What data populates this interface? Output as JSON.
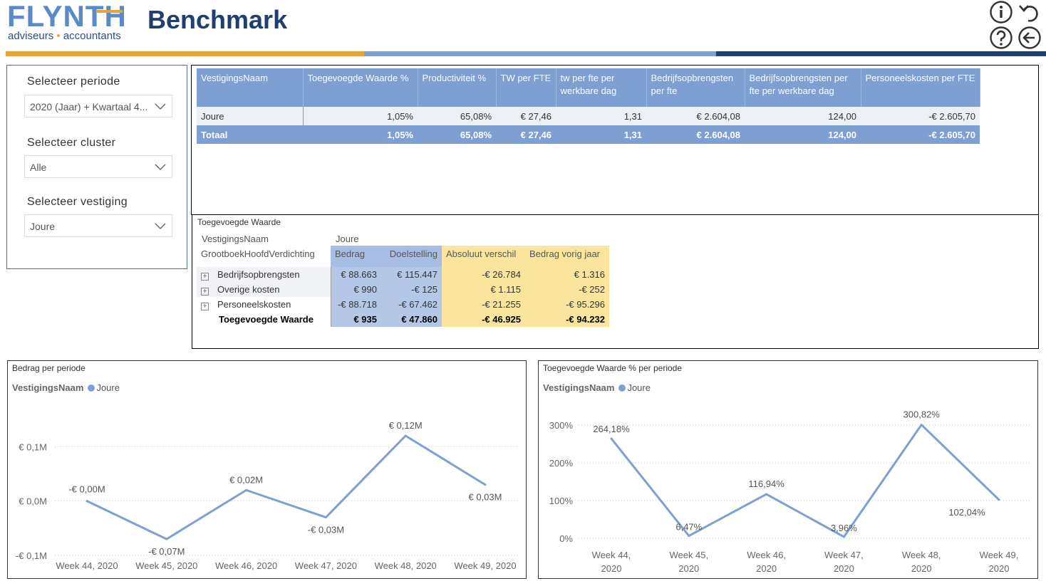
{
  "header": {
    "logo_main": "FLYNTH",
    "logo_sub_left": "adviseurs",
    "logo_sub_dot": "•",
    "logo_sub_right": "accountants",
    "page_title": "Benchmark",
    "bar_colors": [
      "#e8a23a",
      "#7e9fcf",
      "#1f3f73"
    ],
    "icons": [
      "info-icon",
      "undo-icon",
      "help-icon",
      "back-arrow-icon"
    ]
  },
  "slicers": [
    {
      "label": "Selecteer periode",
      "value": "2020 (Jaar) + Kwartaal 4..."
    },
    {
      "label": "Selecteer cluster",
      "value": "Alle"
    },
    {
      "label": "Selecteer vestiging",
      "value": "Joure"
    }
  ],
  "kpi_table": {
    "columns": [
      "VestigingsNaam",
      "Toegevoegde Waarde %",
      "Productiviteit %",
      "TW per FTE",
      "tw per fte per werkbare dag",
      "Bedrijfsopbrengsten per fte",
      "Bedrijfsopbrengsten per fte per werkbare dag",
      "Personeelskosten per FTE"
    ],
    "rows": [
      [
        "Joure",
        "1,05%",
        "65,08%",
        "€ 27,46",
        "1,31",
        "€ 2.604,08",
        "124,00",
        "-€ 2.605,70"
      ]
    ],
    "total": [
      "Totaal",
      "1,05%",
      "65,08%",
      "€ 27,46",
      "1,31",
      "€ 2.604,08",
      "124,00",
      "-€ 2.605,70"
    ]
  },
  "matrix": {
    "title": "Toegevoegde Waarde",
    "row_header_1": "VestigingsNaam",
    "row_header_2": "GrootboekHoofdVerdichting",
    "column_group": "Joure",
    "columns": [
      "Bedrag",
      "Doelstelling",
      "Absoluut verschil",
      "Bedrag vorig jaar"
    ],
    "rows": [
      {
        "label": "Bedrijfsopbrengsten",
        "values": [
          "€ 88.663",
          "€ 115.447",
          "-€ 26.784",
          "€ 1.316"
        ]
      },
      {
        "label": "Overige kosten",
        "values": [
          "€ 990",
          "-€ 125",
          "€ 1.115",
          "-€ 252"
        ]
      },
      {
        "label": "Personeelskosten",
        "values": [
          "-€ 88.718",
          "-€ 67.462",
          "-€ 21.255",
          "-€ 95.296"
        ]
      }
    ],
    "total": {
      "label": "Toegevoegde Waarde",
      "values": [
        "€ 935",
        "€ 47.860",
        "-€ 46.925",
        "-€ 94.232"
      ]
    },
    "expander_symbol": "+"
  },
  "chart_data": [
    {
      "type": "line",
      "title": "Bedrag per periode",
      "legend_title": "VestigingsNaam",
      "x": [
        "Week 44, 2020",
        "Week 45, 2020",
        "Week 46, 2020",
        "Week 47, 2020",
        "Week 48, 2020",
        "Week 49, 2020"
      ],
      "series": [
        {
          "name": "Joure",
          "values": [
            0.0,
            -0.07,
            0.02,
            -0.03,
            0.12,
            0.03
          ],
          "labels": [
            "-€ 0,00M",
            "-€ 0,07M",
            "€ 0,02M",
            "-€ 0,03M",
            "€ 0,12M",
            "€ 0,03M"
          ]
        }
      ],
      "yticks": [
        -0.1,
        0.0,
        0.1
      ],
      "ytick_labels": [
        "-€ 0,1M",
        "€ 0,0M",
        "€ 0,1M"
      ],
      "ylim": [
        -0.1,
        0.12
      ],
      "grid": true,
      "legend_position": "top-left",
      "color": "#7d9fd2"
    },
    {
      "type": "line",
      "title": "Toegevoegde Waarde % per periode",
      "legend_title": "VestigingsNaam",
      "x": [
        "Week 44, 2020",
        "Week 45, 2020",
        "Week 46, 2020",
        "Week 47, 2020",
        "Week 48, 2020",
        "Week 49, 2020"
      ],
      "x_line1": [
        "Week 44,",
        "Week 45,",
        "Week 46,",
        "Week 47,",
        "Week 48,",
        "Week 49,"
      ],
      "x_line2": [
        "2020",
        "2020",
        "2020",
        "2020",
        "2020",
        "2020"
      ],
      "series": [
        {
          "name": "Joure",
          "values": [
            264.18,
            6.47,
            116.94,
            3.96,
            300.82,
            102.04
          ],
          "labels": [
            "264,18%",
            "6,47%",
            "116,94%",
            "3,96%",
            "300,82%",
            "102,04%"
          ]
        }
      ],
      "yticks": [
        0,
        100,
        200,
        300
      ],
      "ytick_labels": [
        "0%",
        "100%",
        "200%",
        "300%"
      ],
      "ylim": [
        0,
        300
      ],
      "grid": true,
      "legend_position": "top-left",
      "color": "#7d9fd2"
    }
  ]
}
